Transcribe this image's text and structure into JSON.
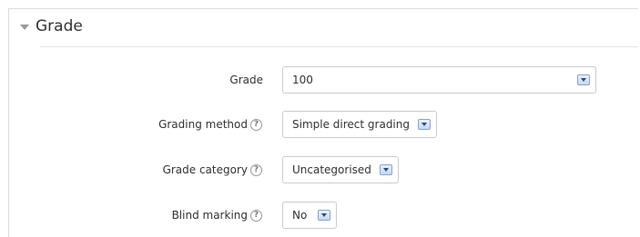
{
  "section": {
    "title": "Grade",
    "toggle_icon": "triangle-down-icon"
  },
  "fields": {
    "grade": {
      "label": "Grade",
      "value": "100"
    },
    "grading_method": {
      "label": "Grading method",
      "value": "Simple direct grading",
      "help_icon": "question-circle-icon"
    },
    "grade_category": {
      "label": "Grade category",
      "value": "Uncategorised",
      "help_icon": "question-circle-icon"
    },
    "blind_marking": {
      "label": "Blind marking",
      "value": "No",
      "help_icon": "question-circle-icon"
    }
  },
  "help_glyph": "?"
}
